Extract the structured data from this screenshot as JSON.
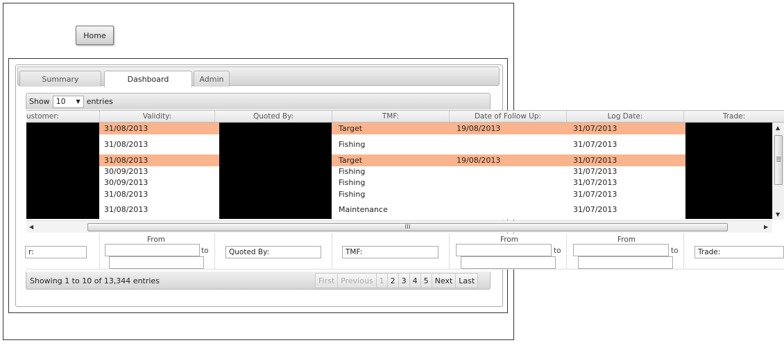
{
  "header": {
    "home_label": "Home"
  },
  "tabs": [
    {
      "label": "Summary"
    },
    {
      "label": "Dashboard"
    },
    {
      "label": "Admin"
    }
  ],
  "length_menu": {
    "show_label": "Show",
    "selected": "10",
    "entries_label": "entries"
  },
  "table": {
    "columns": [
      "ustomer:",
      "Validity:",
      "Quoted By:",
      "TMF:",
      "Date of Follow Up:",
      "Log Date:",
      "Trade:"
    ],
    "rows": [
      {
        "validity": "31/08/2013",
        "tmf": "Target",
        "follow_up": "19/08/2013",
        "log_date": "31/07/2013",
        "highlight": true
      },
      {
        "validity": "31/08/2013",
        "tmf": "Fishing",
        "follow_up": "",
        "log_date": "31/07/2013",
        "highlight": false
      },
      {
        "validity": "31/08/2013",
        "tmf": "Target",
        "follow_up": "19/08/2013",
        "log_date": "31/07/2013",
        "highlight": true
      },
      {
        "validity": "30/09/2013",
        "tmf": "Fishing",
        "follow_up": "",
        "log_date": "31/07/2013",
        "highlight": false
      },
      {
        "validity": "30/09/2013",
        "tmf": "Fishing",
        "follow_up": "",
        "log_date": "31/07/2013",
        "highlight": false
      },
      {
        "validity": "31/08/2013",
        "tmf": "Fishing",
        "follow_up": "",
        "log_date": "31/07/2013",
        "highlight": false
      },
      {
        "validity": "31/08/2013",
        "tmf": "Maintenance",
        "follow_up": "",
        "log_date": "31/07/2013",
        "highlight": false
      }
    ],
    "highlight_color": "#f9b48d"
  },
  "filters": {
    "customer_value": "r:",
    "validity_from_label": "From",
    "validity_to_label": "to",
    "quoted_by_value": "Quoted By:",
    "tmf_value": "TMF:",
    "follow_up_from_label": "From",
    "follow_up_to_label": "to",
    "log_date_from_label": "From",
    "log_date_to_label": "to",
    "trade_value": "Trade:"
  },
  "scrollbar": {
    "grip": "III",
    "vgrip": "☰"
  },
  "footer": {
    "info": "Showing 1 to 10 of 13,344 entries",
    "pager": [
      {
        "label": "First",
        "disabled": true
      },
      {
        "label": "Previous",
        "disabled": true
      },
      {
        "label": "1",
        "disabled": true
      },
      {
        "label": "2",
        "disabled": false
      },
      {
        "label": "3",
        "disabled": false
      },
      {
        "label": "4",
        "disabled": false
      },
      {
        "label": "5",
        "disabled": false
      },
      {
        "label": "Next",
        "disabled": false
      },
      {
        "label": "Last",
        "disabled": false
      }
    ]
  }
}
